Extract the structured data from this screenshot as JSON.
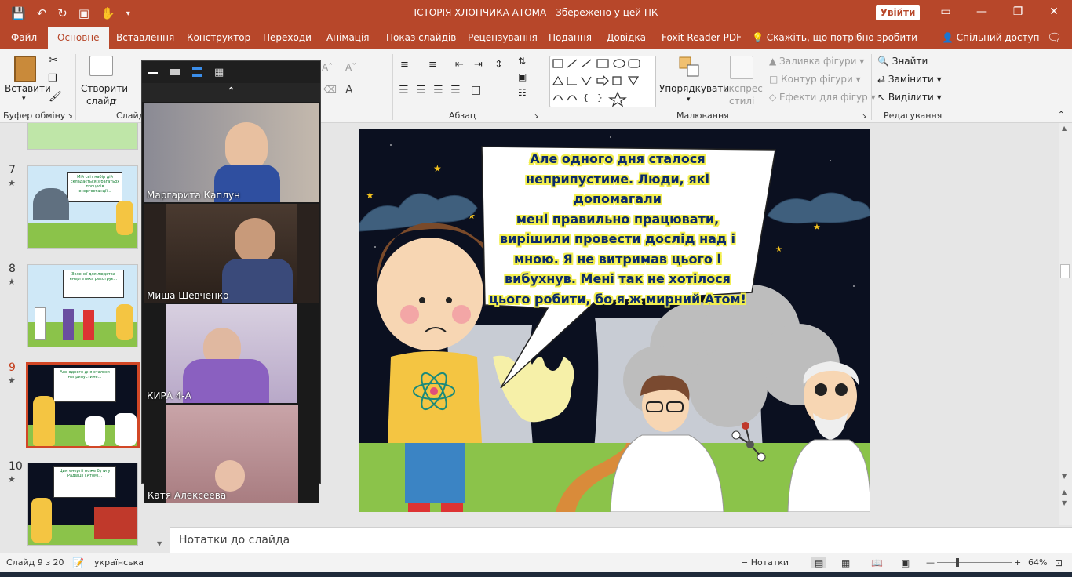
{
  "window": {
    "title": "ІСТОРІЯ ХЛОПЧИКА АТОМА  -  Збережено у цей ПК",
    "signin_label": "Увійти"
  },
  "menu": {
    "tabs": [
      "Файл",
      "Основне",
      "Вставлення",
      "Конструктор",
      "Переходи",
      "Анімація",
      "Показ слайдів",
      "Рецензування",
      "Подання",
      "Довідка",
      "Foxit Reader PDF"
    ],
    "active_tab": "Основне",
    "tell_me": "Скажіть, що потрібно зробити",
    "share": "Спільний доступ"
  },
  "ribbon": {
    "paste": "Вставити",
    "new_slide": "Створити",
    "new_slide_2": "слайд",
    "arrange": "Упорядкувати",
    "quick_styles": "Експрес-",
    "quick_styles_2": "стилі",
    "shape_fill": "Заливка фігури",
    "shape_outline": "Контур фігури",
    "shape_effects": "Ефекти для фігур",
    "find": "Знайти",
    "replace": "Замінити",
    "select": "Виділити",
    "groups": {
      "clipboard": "Буфер обміну",
      "slides": "Слайд",
      "paragraph": "Абзац",
      "drawing": "Малювання",
      "editing": "Редагування"
    }
  },
  "thumbnails": [
    {
      "num": "7",
      "text": "Мій світ набір дій складається з багатьох процесів енергостанції..."
    },
    {
      "num": "8",
      "text": "Зеленої для людства енергетика реєструє..."
    },
    {
      "num": "9",
      "text": "Але одного дня сталося неприпустиме..."
    },
    {
      "num": "10",
      "text": "Цим енергії може бути у Радіації і Атомі..."
    }
  ],
  "video": {
    "participants": [
      "Маргарита Каплун",
      "Миша Шевченко",
      "КИРА 4-А",
      "Катя Алексеева"
    ]
  },
  "slide": {
    "speech_lines": [
      "Але одного дня сталося",
      "неприпустиме. Люди, які допомагали",
      "мені правильно працювати,",
      "вирішили провести дослід над і",
      "мною. Я не витримав цього і",
      "вибухнув. Мені так не хотілося",
      "цього робити, бо я ж мирний Атом!"
    ]
  },
  "notes": {
    "placeholder": "Нотатки до слайда"
  },
  "status": {
    "slide_counter": "Слайд 9 з 20",
    "language": "українська",
    "notes_btn": "Нотатки",
    "zoom": "64%"
  }
}
